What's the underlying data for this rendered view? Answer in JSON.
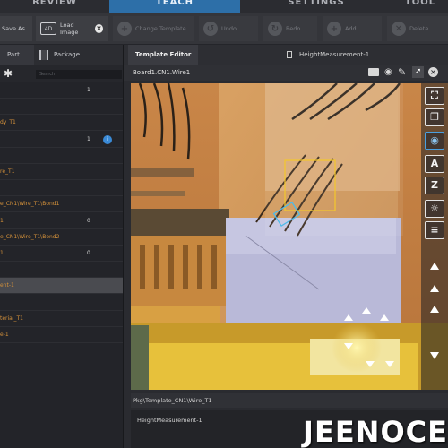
{
  "modes": [
    {
      "label": "REVIEW",
      "active": false
    },
    {
      "label": "TEACH",
      "active": true
    },
    {
      "label": "SETTINGS",
      "active": false
    },
    {
      "label": "TOOL",
      "active": false
    }
  ],
  "toolbar": {
    "save_as": "Save As",
    "load_image": "Load Image",
    "load_image_badge": "x",
    "change_template": "Change Template",
    "undo": "Undo",
    "redo": "Redo",
    "add": "Add",
    "delete": "Delete"
  },
  "left_panel": {
    "tabs": [
      {
        "label": "Part",
        "active": true
      },
      {
        "label": "Package",
        "active": false
      }
    ],
    "search_placeholder": "Search",
    "rows": [
      {
        "label": "",
        "value": "1"
      },
      {
        "label": "",
        "value": ""
      },
      {
        "label": "dy_T1",
        "value": ""
      },
      {
        "label": "",
        "value": "1",
        "info": true
      },
      {
        "label": "",
        "value": ""
      },
      {
        "label": "re_T1",
        "value": ""
      },
      {
        "label": "",
        "value": ""
      },
      {
        "label": "e_CN1\\Wire_T1\\Bond1",
        "value": ""
      },
      {
        "label": "1",
        "value": "0"
      },
      {
        "label": "e_CN1\\Wire_T1\\Bond2",
        "value": ""
      },
      {
        "label": "1",
        "value": "0"
      },
      {
        "label": "",
        "value": ""
      },
      {
        "label": "ent-1",
        "value": "",
        "selected": true
      },
      {
        "label": "",
        "value": ""
      },
      {
        "label": "terial_T1",
        "value": ""
      },
      {
        "label": "e-1",
        "value": ""
      }
    ]
  },
  "editor": {
    "tab_active": "Template Editor",
    "tab_other": "HeightMeasurement-1",
    "view_title": "Board1.CN1.Wire1",
    "side_tools": [
      "⛶",
      "❐",
      "◉",
      "A",
      "Z",
      "☼",
      "≡"
    ],
    "path": "Pkg\\Template_CN1\\Wire_T1",
    "list_item": "HeightMeasurement-1"
  },
  "watermark": "JEENOCE"
}
